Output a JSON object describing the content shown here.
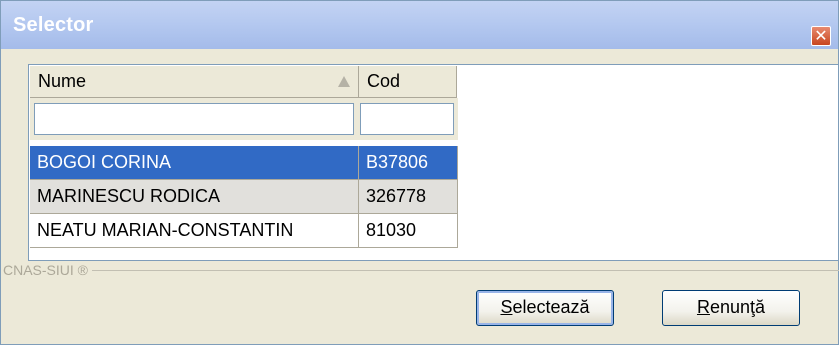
{
  "window": {
    "title": "Selector",
    "close_glyph": "✕"
  },
  "grid": {
    "columns": [
      {
        "label": "Nume",
        "sort": "ascending"
      },
      {
        "label": "Cod"
      }
    ],
    "filters": {
      "nume": "",
      "cod": ""
    },
    "rows": [
      {
        "nume": "BOGOI CORINA",
        "cod": "B37806",
        "selected": true
      },
      {
        "nume": "MARINESCU RODICA",
        "cod": "326778",
        "selected": false
      },
      {
        "nume": "NEATU MARIAN-CONSTANTIN",
        "cod": "81030",
        "selected": false
      }
    ]
  },
  "footer": {
    "brand": "CNAS-SIUI ®",
    "select_label_first": "S",
    "select_label_rest": "electează",
    "cancel_label_first": "R",
    "cancel_label_rest": "enunţă"
  },
  "colors": {
    "selection": "#316ac5",
    "title_gradient_end": "#a4bbea",
    "window_bg": "#ece9d8"
  }
}
